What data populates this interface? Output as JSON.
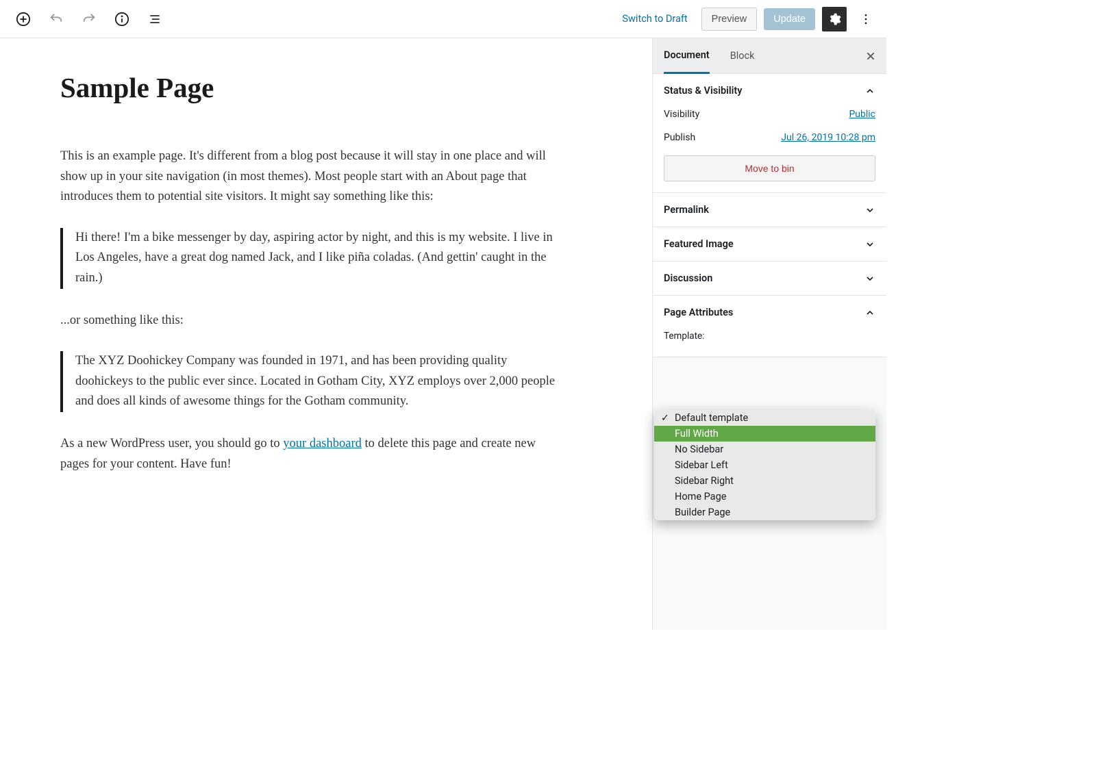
{
  "toolbar": {
    "switch_to_draft": "Switch to Draft",
    "preview": "Preview",
    "update": "Update"
  },
  "sidebar_tabs": {
    "document": "Document",
    "block": "Block"
  },
  "panels": {
    "status_visibility": "Status & Visibility",
    "visibility_label": "Visibility",
    "visibility_value": "Public",
    "publish_label": "Publish",
    "publish_value": "Jul 26, 2019 10:28 pm",
    "move_to_bin": "Move to bin",
    "permalink": "Permalink",
    "featured_image": "Featured Image",
    "discussion": "Discussion",
    "page_attributes": "Page Attributes",
    "template_label": "Template:"
  },
  "template_options": [
    {
      "label": "Default template",
      "checked": true,
      "selected": false
    },
    {
      "label": "Full Width",
      "checked": false,
      "selected": true
    },
    {
      "label": "No Sidebar",
      "checked": false,
      "selected": false
    },
    {
      "label": "Sidebar Left",
      "checked": false,
      "selected": false
    },
    {
      "label": "Sidebar Right",
      "checked": false,
      "selected": false
    },
    {
      "label": "Home Page",
      "checked": false,
      "selected": false
    },
    {
      "label": "Builder Page",
      "checked": false,
      "selected": false
    }
  ],
  "content": {
    "title": "Sample Page",
    "p1": "This is an example page. It's different from a blog post because it will stay in one place and will show up in your site navigation (in most themes). Most people start with an About page that introduces them to potential site visitors. It might say something like this:",
    "q1": "Hi there! I'm a bike messenger by day, aspiring actor by night, and this is my website. I live in Los Angeles, have a great dog named Jack, and I like piña coladas. (And gettin' caught in the rain.)",
    "p2": "...or something like this:",
    "q2": "The XYZ Doohickey Company was founded in 1971, and has been providing quality doohickeys to the public ever since. Located in Gotham City, XYZ employs over 2,000 people and does all kinds of awesome things for the Gotham community.",
    "p3a": "As a new WordPress user, you should go to ",
    "p3link": "your dashboard",
    "p3b": " to delete this page and create new pages for your content. Have fun!"
  }
}
